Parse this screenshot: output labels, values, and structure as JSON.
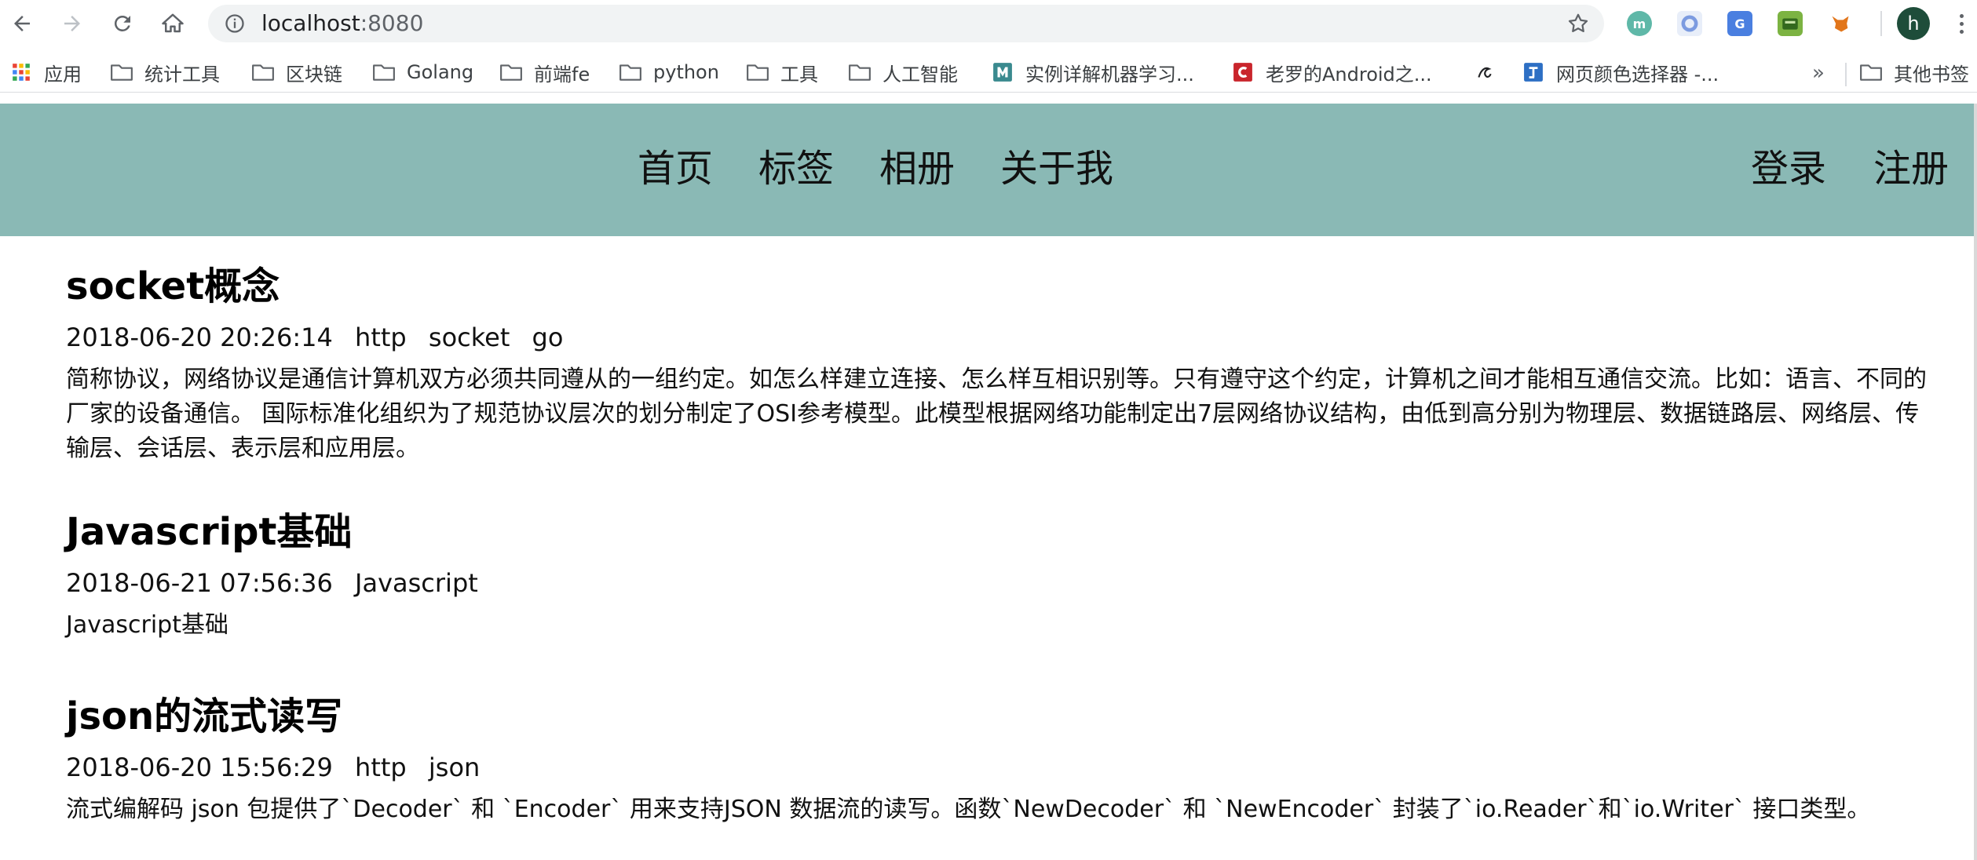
{
  "browser": {
    "url_host": "localhost",
    "url_port": ":8080",
    "avatar_letter": "h",
    "extensions": [
      "m-icon",
      "loop-icon",
      "translate-icon",
      "card-icon",
      "fox-icon"
    ]
  },
  "bookmarks": {
    "items": [
      {
        "label": "应用",
        "icon": "apps-grid-icon"
      },
      {
        "label": "统计工具",
        "icon": "folder-icon"
      },
      {
        "label": "区块链",
        "icon": "folder-icon"
      },
      {
        "label": "Golang",
        "icon": "folder-icon"
      },
      {
        "label": "前端fe",
        "icon": "folder-icon"
      },
      {
        "label": "python",
        "icon": "folder-icon"
      },
      {
        "label": "工具",
        "icon": "folder-icon"
      },
      {
        "label": "人工智能",
        "icon": "folder-icon"
      },
      {
        "label": "实例详解机器学习...",
        "icon": "m-site-icon"
      },
      {
        "label": "老罗的Android之...",
        "icon": "c-site-icon"
      },
      {
        "label": "",
        "icon": "script-site-icon"
      },
      {
        "label": "网页颜色选择器 -...",
        "icon": "color-picker-icon"
      }
    ],
    "overflow": "»",
    "other": "其他书签"
  },
  "site": {
    "nav": [
      "首页",
      "标签",
      "相册",
      "关于我"
    ],
    "login": "登录",
    "register": "注册"
  },
  "articles": [
    {
      "title": "socket概念",
      "date": "2018-06-20 20:26:14",
      "tags": [
        "http",
        "socket",
        "go"
      ],
      "summary": "简称协议，网络协议是通信计算机双方必须共同遵从的一组约定。如怎么样建立连接、怎么样互相识别等。只有遵守这个约定，计算机之间才能相互通信交流。比如：语言、不同的厂家的设备通信。 国际标准化组织为了规范协议层次的划分制定了OSI参考模型。此模型根据网络功能制定出7层网络协议结构，由低到高分别为物理层、数据链路层、网络层、传输层、会话层、表示层和应用层。"
    },
    {
      "title": "Javascript基础",
      "date": "2018-06-21 07:56:36",
      "tags": [
        "Javascript"
      ],
      "summary": "Javascript基础"
    },
    {
      "title": "json的流式读写",
      "date": "2018-06-20 15:56:29",
      "tags": [
        "http",
        "json"
      ],
      "summary": "流式编解码 json 包提供了`Decoder` 和 `Encoder` 用来支持JSON 数据流的读写。函数`NewDecoder` 和 `NewEncoder` 封装了`io.Reader`和`io.Writer` 接口类型。"
    }
  ],
  "colors": {
    "header_bg": "#8ab9b5"
  }
}
